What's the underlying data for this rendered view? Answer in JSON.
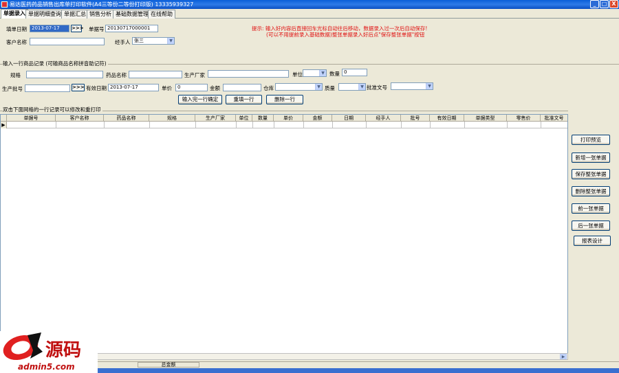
{
  "window": {
    "title": "易达医药药品销售出库单打印软件(A4三等份二等份打印版) 13335939327",
    "minimize": "_",
    "maximize": "□",
    "close": "X"
  },
  "tabs": [
    "单据录入",
    "单据明细查询",
    "单据汇总",
    "销售分析",
    "基础数据管理",
    "在线帮助"
  ],
  "header": {
    "fill_date_label": "填单日期",
    "fill_date_value": "2013-07-17",
    "picker_button": ">>>",
    "doc_no_label": "单据号",
    "doc_no_value": "20130717000001",
    "customer_label": "客户名称",
    "customer_value": "",
    "handler_label": "经手人",
    "handler_value": "张三"
  },
  "tip": {
    "line1": "提示: 输入好内容后直接回车光标自动往后移动，数据录入过一次后自动保存!",
    "line2": "(可以不用提前录入基础数据)整张单据录入好后点\"保存整张单据\"按钮"
  },
  "entry": {
    "section_title": "输入一行商品记录 (可输商品名称拼音助记符)",
    "spec_label": "规格",
    "drug_name_label": "药品名称",
    "maker_label": "生产厂家",
    "unit_label": "单位",
    "qty_label": "数量",
    "qty_value": "0",
    "batch_label": "生产批号",
    "picker_button": ">>>",
    "expiry_label": "有效日期",
    "expiry_value": "2013-07-17",
    "price_label": "单价",
    "price_value": "0",
    "amount_label": "金额",
    "warehouse_label": "仓库",
    "quality_label": "质量",
    "approval_label": "批准文号",
    "confirm_button": "输入完一行确定",
    "refill_button": "重填一行",
    "delete_button": "删除一行"
  },
  "grid": {
    "section_title": "双击下面网格的一行记录可以修改和重打印",
    "columns": [
      "单据号",
      "客户名称",
      "药品名称",
      "规格",
      "生产厂家",
      "单位",
      "数量",
      "单价",
      "金额",
      "日期",
      "经手人",
      "批号",
      "有效日期",
      "单据类型",
      "零售价",
      "批准文号"
    ],
    "row_indicator": "▶"
  },
  "side_buttons": [
    "打印预览",
    "新增一张单据",
    "保存整张单据",
    "删除整张单据",
    "前一张单据",
    "后一张单据",
    "报表设计"
  ],
  "status": {
    "total_label": "总金额"
  },
  "watermark": {
    "brand": "a5源码",
    "url": "admin5.com"
  },
  "colors": {
    "titlebar": "#0a5fd8",
    "tip_text": "#e01010",
    "selection": "#3169c6",
    "panel": "#ece9d8"
  }
}
